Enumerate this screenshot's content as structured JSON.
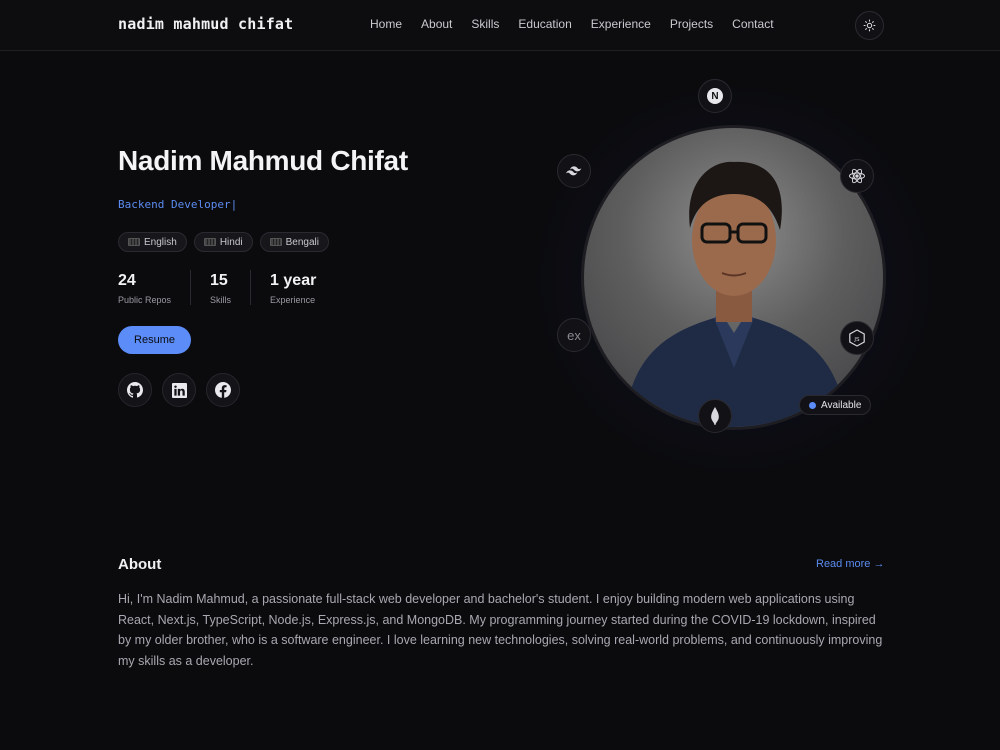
{
  "nav": {
    "brand": "nadim mahmud chifat",
    "links": [
      "Home",
      "About",
      "Skills",
      "Education",
      "Experience",
      "Projects",
      "Contact"
    ],
    "theme_icon": "sun-icon"
  },
  "hero": {
    "name": "Nadim Mahmud Chifat",
    "role": "Backend Developer|",
    "languages": [
      "English",
      "Hindi",
      "Bengali"
    ],
    "stats": [
      {
        "value": "24",
        "label": "Public Repos"
      },
      {
        "value": "15",
        "label": "Skills"
      },
      {
        "value": "1 year",
        "label": "Experience"
      }
    ],
    "resume_label": "Resume",
    "socials": [
      "github-icon",
      "linkedin-icon",
      "facebook-icon"
    ],
    "orbit_icons": [
      "nextjs-icon",
      "tailwind-icon",
      "react-icon",
      "express-icon",
      "nodejs-icon",
      "mongodb-icon"
    ],
    "express_text": "ex",
    "nextjs_text": "N",
    "status": "Available"
  },
  "about": {
    "title": "About",
    "read_more": "Read more →",
    "text": "Hi, I'm Nadim Mahmud, a passionate full-stack web developer and bachelor's student. I enjoy building modern web applications using React, Next.js, TypeScript, Node.js, Express.js, and MongoDB. My programming journey started during the COVID-19 lockdown, inspired by my older brother, who is a software engineer. I love learning new technologies, solving real-world problems, and continuously improving my skills as a developer."
  },
  "colors": {
    "background": "#0b0b0e",
    "accent": "#5b8cf7",
    "text": "#e8e8ea",
    "muted": "#a8a8b0"
  }
}
